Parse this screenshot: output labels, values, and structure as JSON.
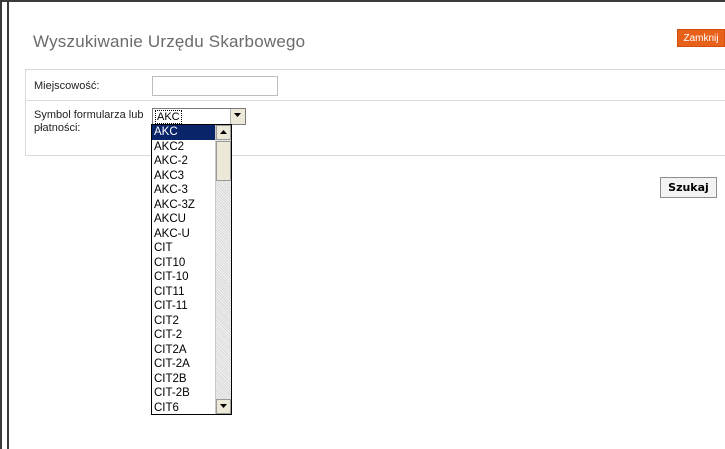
{
  "dialog": {
    "title": "Wyszukiwanie Urzędu Skarbowego",
    "close_label": "Zamknij"
  },
  "form": {
    "city_label": "Miejscowość:",
    "city_value": "",
    "symbol_label": "Symbol formularza lub płatności:",
    "symbol_selected": "AKC",
    "options": [
      "AKC",
      "AKC2",
      "AKC-2",
      "AKC3",
      "AKC-3",
      "AKC-3Z",
      "AKCU",
      "AKC-U",
      "CIT",
      "CIT10",
      "CIT-10",
      "CIT11",
      "CIT-11",
      "CIT2",
      "CIT-2",
      "CIT2A",
      "CIT-2A",
      "CIT2B",
      "CIT-2B",
      "CIT6"
    ]
  },
  "search_label": "Szukaj",
  "colors": {
    "accent": "#e8611b",
    "selection": "#0a246a"
  }
}
